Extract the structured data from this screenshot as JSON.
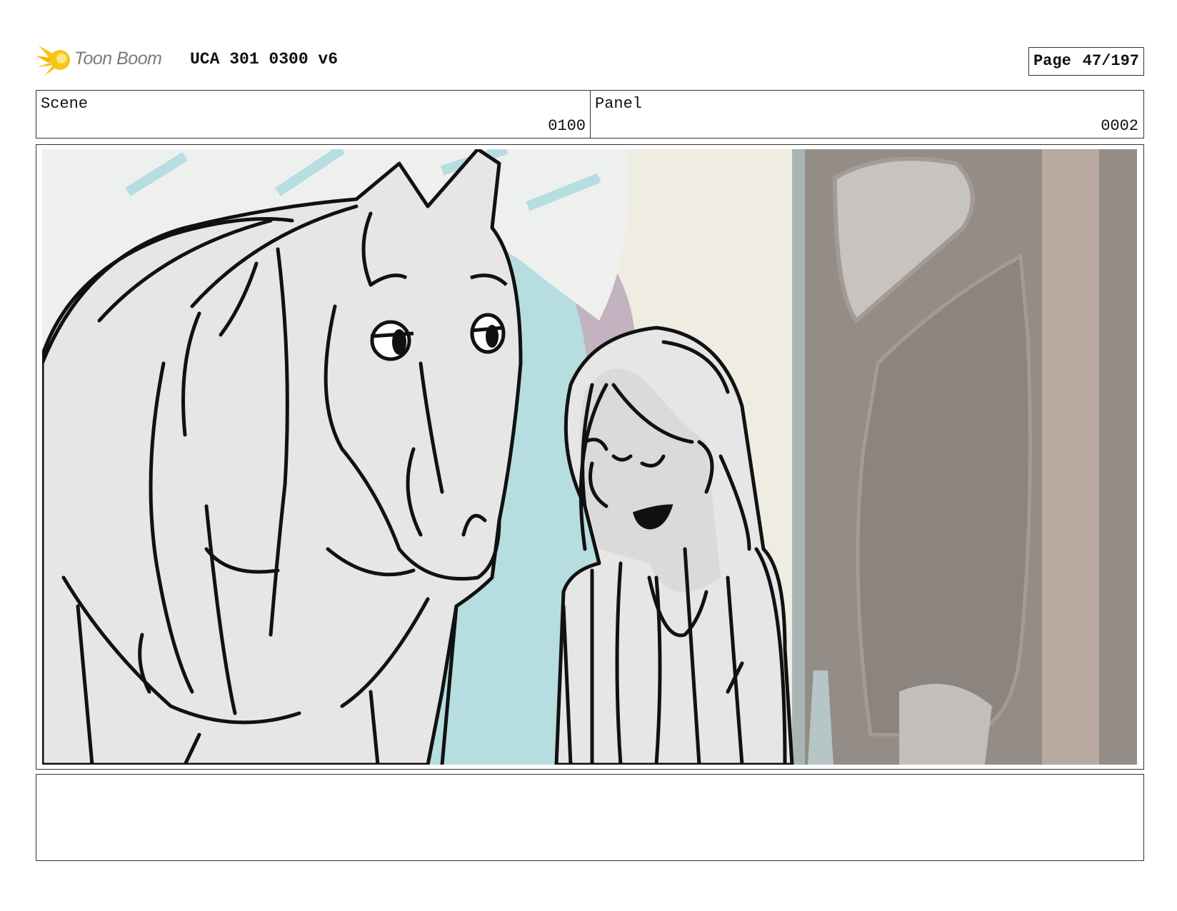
{
  "header": {
    "logo_text": "Toon Boom",
    "title": "UCA 301 0300 v6",
    "page_label": "Page",
    "page_number": "47/197"
  },
  "info": {
    "scene_label": "Scene",
    "scene_value": "0100",
    "panel_label": "Panel",
    "panel_value": "0002"
  },
  "colors": {
    "logo_yellow": "#f5c518",
    "border": "#333333",
    "sketch_fill": "#e6e6e6",
    "wall": "#efece2",
    "door": "#938c87",
    "window_blue": "#b6dde0",
    "arch_mauve": "#c3b2bf"
  },
  "notes": {
    "text": ""
  }
}
